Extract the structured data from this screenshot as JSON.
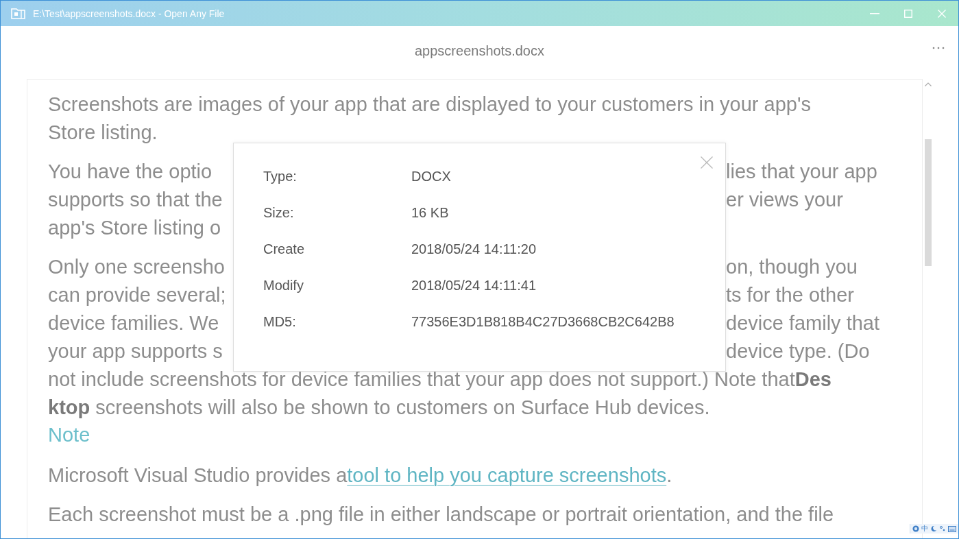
{
  "window": {
    "title": "E:\\Test\\appscreenshots.docx - Open Any File"
  },
  "header": {
    "filename": "appscreenshots.docx"
  },
  "document": {
    "paragraphs": [
      {
        "kind": "text",
        "lines": [
          {
            "kind": "full",
            "text": "Screenshots are images of your app that are displayed to your customers in your app's"
          },
          {
            "kind": "full",
            "text": "Store listing."
          }
        ]
      },
      {
        "kind": "text",
        "lines": [
          {
            "kind": "split",
            "left": "You have the optio",
            "right": "lies that your app"
          },
          {
            "kind": "split",
            "left": "supports so that the",
            "right": "er views your"
          },
          {
            "kind": "split",
            "left": "app's Store listing o"
          }
        ]
      },
      {
        "kind": "text",
        "lines": [
          {
            "kind": "split",
            "left": "Only one screensho",
            "right": "on, though you"
          },
          {
            "kind": "split",
            "left": "can provide several;",
            "right": "ts for the other"
          },
          {
            "kind": "split",
            "left": "device families. We",
            "right": "device family that"
          },
          {
            "kind": "split",
            "left": "your app supports s",
            "right": "device type. (Do"
          },
          {
            "kind": "full",
            "text": "not include screenshots for device families that your app does not support.) Note that**Des**"
          },
          {
            "kind": "full",
            "text": "**ktop** screenshots will also be shown to customers on Surface Hub devices."
          }
        ]
      },
      {
        "kind": "note",
        "text": "Note"
      },
      {
        "kind": "link_line",
        "text": "Microsoft Visual Studio provides a",
        "link": "tool to help you capture screenshots",
        "after": "."
      },
      {
        "kind": "text",
        "lines": [
          {
            "kind": "full",
            "text": "Each screenshot must be a .png file in either landscape or portrait orientation, and the file"
          }
        ]
      }
    ]
  },
  "dialog": {
    "rows": [
      {
        "label": "Type:",
        "value": "DOCX"
      },
      {
        "label": "Size:",
        "value": "16 KB"
      },
      {
        "label": "Create",
        "value": "2018/05/24 14:11:20"
      },
      {
        "label": "Modify",
        "value": "2018/05/24 14:11:41"
      },
      {
        "label": "MD5:",
        "value": "77356E3D1B818B4C27D3668CB2C642B8"
      }
    ]
  },
  "ime_toolbar": {
    "mode": "中"
  }
}
